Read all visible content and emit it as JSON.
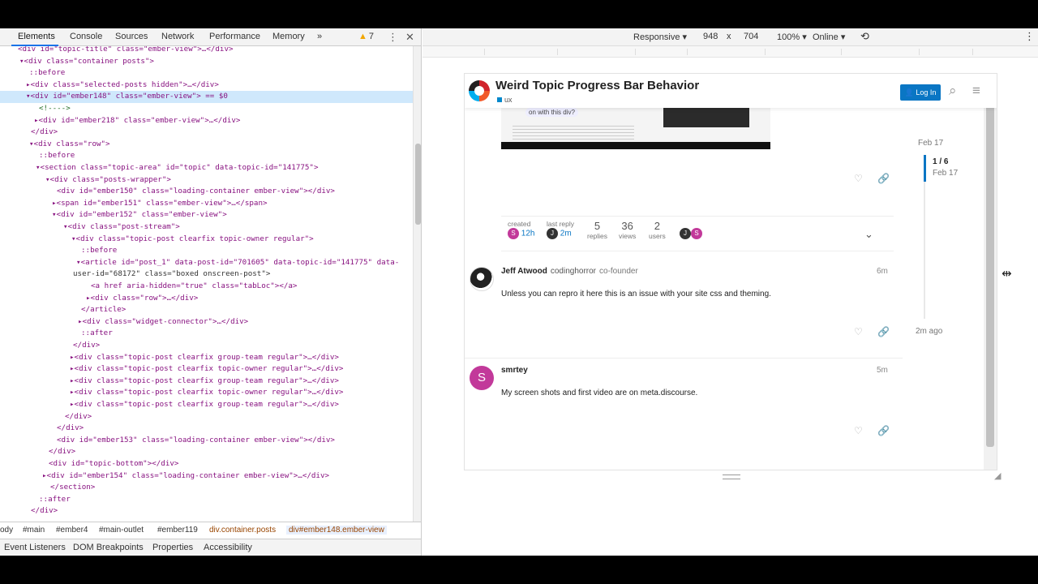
{
  "devtools": {
    "tabs": [
      "Elements",
      "Console",
      "Sources",
      "Network",
      "Performance",
      "Memory"
    ],
    "more_tabs": "»",
    "warnings": "7",
    "kebab": "⋮",
    "close": "✕",
    "dom_lines": [
      {
        "t": "<div id=\"topic-title\" class=\"ember-view\">…</div>"
      },
      {
        "t": "▾<div class=\"container posts\">"
      },
      {
        "t": "::before"
      },
      {
        "t": "▸<div class=\"selected-posts hidden\">…</div>"
      },
      {
        "t": "▾<div id=\"ember148\" class=\"ember-view\"> == $0"
      },
      {
        "t": "<!---->"
      },
      {
        "t": "▸<div id=\"ember218\" class=\"ember-view\">…</div>"
      },
      {
        "t": "</div>"
      },
      {
        "t": "▾<div class=\"row\">"
      },
      {
        "t": "::before"
      },
      {
        "t": "▾<section class=\"topic-area\" id=\"topic\" data-topic-id=\"141775\">"
      },
      {
        "t": "▾<div class=\"posts-wrapper\">"
      },
      {
        "t": "<div id=\"ember150\" class=\"loading-container ember-view\"></div>"
      },
      {
        "t": "▸<span id=\"ember151\" class=\"ember-view\">…</span>"
      },
      {
        "t": "▾<div id=\"ember152\" class=\"ember-view\">"
      },
      {
        "t": "▾<div class=\"post-stream\">"
      },
      {
        "t": "▾<div class=\"topic-post clearfix topic-owner regular\">"
      },
      {
        "t": "::before"
      },
      {
        "t": "▾<article id=\"post_1\" data-post-id=\"701605\" data-topic-id=\"141775\" data-"
      },
      {
        "t": "user-id=\"68172\" class=\"boxed onscreen-post\">"
      },
      {
        "t": "<a href aria-hidden=\"true\" class=\"tabLoc\"></a>"
      },
      {
        "t": "▸<div class=\"row\">…</div>"
      },
      {
        "t": "</article>"
      },
      {
        "t": "▸<div class=\"widget-connector\">…</div>"
      },
      {
        "t": "::after"
      },
      {
        "t": "</div>"
      },
      {
        "t": "▸<div class=\"topic-post clearfix group-team regular\">…</div>"
      },
      {
        "t": "▸<div class=\"topic-post clearfix topic-owner regular\">…</div>"
      },
      {
        "t": "▸<div class=\"topic-post clearfix group-team regular\">…</div>"
      },
      {
        "t": "▸<div class=\"topic-post clearfix topic-owner regular\">…</div>"
      },
      {
        "t": "▸<div class=\"topic-post clearfix group-team regular\">…</div>"
      },
      {
        "t": "</div>"
      },
      {
        "t": "</div>"
      },
      {
        "t": "<div id=\"ember153\" class=\"loading-container ember-view\"></div>"
      },
      {
        "t": "</div>"
      },
      {
        "t": "<div id=\"topic-bottom\"></div>"
      },
      {
        "t": "▸<div id=\"ember154\" class=\"loading-container ember-view\">…</div>"
      },
      {
        "t": "</section>"
      },
      {
        "t": "::after"
      },
      {
        "t": "</div>"
      }
    ],
    "breadcrumbs": [
      "ody",
      "#main",
      "#ember4",
      "#main-outlet",
      "#ember119",
      "div.container.posts",
      "div#ember148.ember-view"
    ],
    "subtabs": [
      "Event Listeners",
      "DOM Breakpoints",
      "Properties",
      "Accessibility"
    ]
  },
  "device_toolbar": {
    "mode": "Responsive ▾",
    "width": "948",
    "times": "x",
    "height": "704",
    "zoom": "100% ▾",
    "network": "Online ▾",
    "rotate": "⟲",
    "kebab": "⋮"
  },
  "page": {
    "title": "Weird Topic Progress Bar Behavior",
    "category": "ux",
    "login": "Log In",
    "image_bubble": "on with this div?",
    "topic_map": {
      "created_label": "created",
      "created_time": "12h",
      "last_reply_label": "last reply",
      "last_reply_time": "2m",
      "replies": "5",
      "replies_label": "replies",
      "views": "36",
      "views_label": "views",
      "users": "2",
      "users_label": "users"
    },
    "posts": [
      {
        "name": "Jeff Atwood",
        "username": "codinghorror",
        "title": "co-founder",
        "time": "6m",
        "body": "Unless you can repro it here this is an issue with your site css and theming."
      },
      {
        "name": "smrtey",
        "username": "",
        "title": "",
        "time": "5m",
        "body": "My screen shots and first video are on meta.discourse."
      }
    ],
    "timeline": {
      "top_date": "Feb 17",
      "count": "1 / 6",
      "handle_date": "Feb 17",
      "bottom": "2m ago"
    }
  },
  "colors": {
    "accent": "#0a76c4",
    "selection": "#cfe8fc",
    "avatar_s": "#c2399a"
  }
}
